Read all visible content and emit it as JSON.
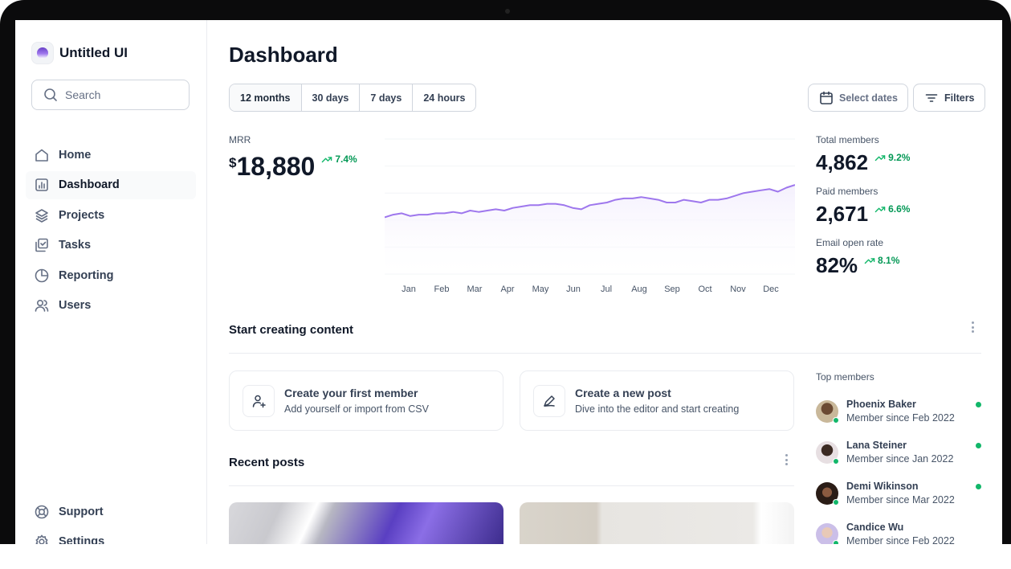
{
  "app": {
    "name": "Untitled UI"
  },
  "search": {
    "placeholder": "Search"
  },
  "nav": [
    {
      "label": "Home",
      "icon": "home-icon"
    },
    {
      "label": "Dashboard",
      "icon": "bar-chart-icon",
      "active": true
    },
    {
      "label": "Projects",
      "icon": "layers-icon"
    },
    {
      "label": "Tasks",
      "icon": "check-square-icon"
    },
    {
      "label": "Reporting",
      "icon": "pie-chart-icon"
    },
    {
      "label": "Users",
      "icon": "users-icon"
    }
  ],
  "nav_bottom": [
    {
      "label": "Support",
      "icon": "life-buoy-icon"
    },
    {
      "label": "Settings",
      "icon": "settings-icon"
    }
  ],
  "page": {
    "title": "Dashboard"
  },
  "ranges": [
    "12 months",
    "30 days",
    "7 days",
    "24 hours"
  ],
  "actions": {
    "select_dates": "Select dates",
    "filters": "Filters"
  },
  "mrr": {
    "label": "MRR",
    "currency": "$",
    "value": "18,880",
    "change": "7.4%"
  },
  "stats": [
    {
      "label": "Total members",
      "value": "4,862",
      "change": "9.2%"
    },
    {
      "label": "Paid members",
      "value": "2,671",
      "change": "6.6%"
    },
    {
      "label": "Email open rate",
      "value": "82%",
      "change": "8.1%"
    }
  ],
  "chart_data": {
    "type": "area",
    "categories": [
      "Jan",
      "Feb",
      "Mar",
      "Apr",
      "May",
      "Jun",
      "Jul",
      "Aug",
      "Sep",
      "Oct",
      "Nov",
      "Dec"
    ],
    "x": [
      0,
      1,
      2,
      3,
      4,
      5,
      6,
      7,
      8,
      9,
      10,
      11,
      12,
      13,
      14,
      15,
      16,
      17,
      18,
      19,
      20,
      21,
      22,
      23,
      24,
      25,
      26,
      27,
      28,
      29,
      30,
      31,
      32,
      33,
      34,
      35,
      36,
      37,
      38,
      39,
      40,
      41,
      42,
      43,
      44,
      45,
      46,
      47,
      48
    ],
    "values": [
      42,
      44,
      45,
      43,
      44,
      44,
      45,
      45,
      46,
      45,
      47,
      46,
      47,
      48,
      47,
      49,
      50,
      51,
      51,
      52,
      52,
      51,
      49,
      48,
      51,
      52,
      53,
      55,
      56,
      56,
      57,
      56,
      55,
      53,
      53,
      55,
      54,
      53,
      55,
      55,
      56,
      58,
      60,
      61,
      62,
      63,
      61,
      64,
      66
    ],
    "ylim": [
      0,
      100
    ],
    "grid": true,
    "colors": {
      "line": "#9e77ed",
      "fill": "#f4f0fd"
    }
  },
  "content": {
    "title": "Start creating content",
    "cards": [
      {
        "title": "Create your first member",
        "subtitle": "Add yourself or import from CSV",
        "icon": "user-plus-icon"
      },
      {
        "title": "Create a new post",
        "subtitle": "Dive into the editor and start creating",
        "icon": "pen-icon"
      }
    ]
  },
  "recent": {
    "title": "Recent posts"
  },
  "top_members": {
    "title": "Top members",
    "items": [
      {
        "name": "Phoenix Baker",
        "since": "Member since Feb 2022"
      },
      {
        "name": "Lana Steiner",
        "since": "Member since Jan 2022"
      },
      {
        "name": "Demi Wikinson",
        "since": "Member since Mar 2022"
      },
      {
        "name": "Candice Wu",
        "since": "Member since Feb 2022"
      }
    ]
  },
  "colors": {
    "accent": "#7f56d9",
    "success": "#039855",
    "status": "#12b76a"
  }
}
